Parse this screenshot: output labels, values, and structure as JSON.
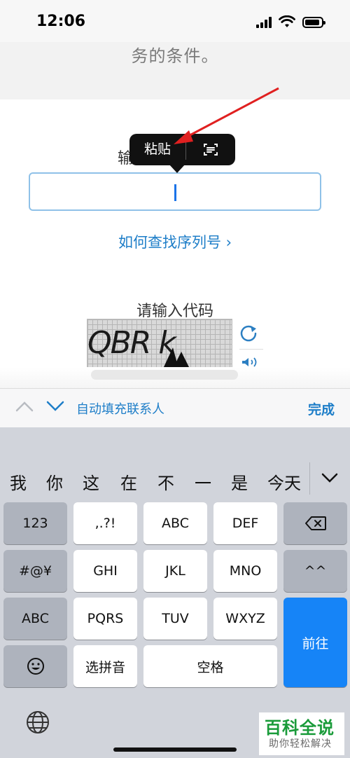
{
  "status_bar": {
    "time": "12:06"
  },
  "content": {
    "terms_text": "务的条件。",
    "input_label": "输",
    "serial_input_value": "",
    "paste_menu": {
      "paste_label": "粘贴",
      "scan_icon": "scan-text-icon"
    },
    "find_serial_link": "如何查找序列号 ›",
    "captcha_label": "请输入代码",
    "captcha_text": "QBR k",
    "refresh_icon": "refresh-icon",
    "audio_icon": "speaker-icon"
  },
  "accessory_bar": {
    "autofill_label": "自动填充联系人",
    "done_label": "完成"
  },
  "keyboard": {
    "candidates": [
      "我",
      "你",
      "这",
      "在",
      "不",
      "一",
      "是",
      "今天"
    ],
    "row1": [
      "123",
      ",.?!",
      "ABC",
      "DEF"
    ],
    "row2": [
      "#@¥",
      "GHI",
      "JKL",
      "MNO",
      "^^"
    ],
    "row3": [
      "ABC",
      "PQRS",
      "TUV",
      "WXYZ"
    ],
    "row4": [
      "选拼音",
      "空格"
    ],
    "go_label": "前往",
    "accent_color": "#1684f7"
  },
  "watermark": {
    "title": "百科全说",
    "subtitle": "助你轻松解决"
  }
}
